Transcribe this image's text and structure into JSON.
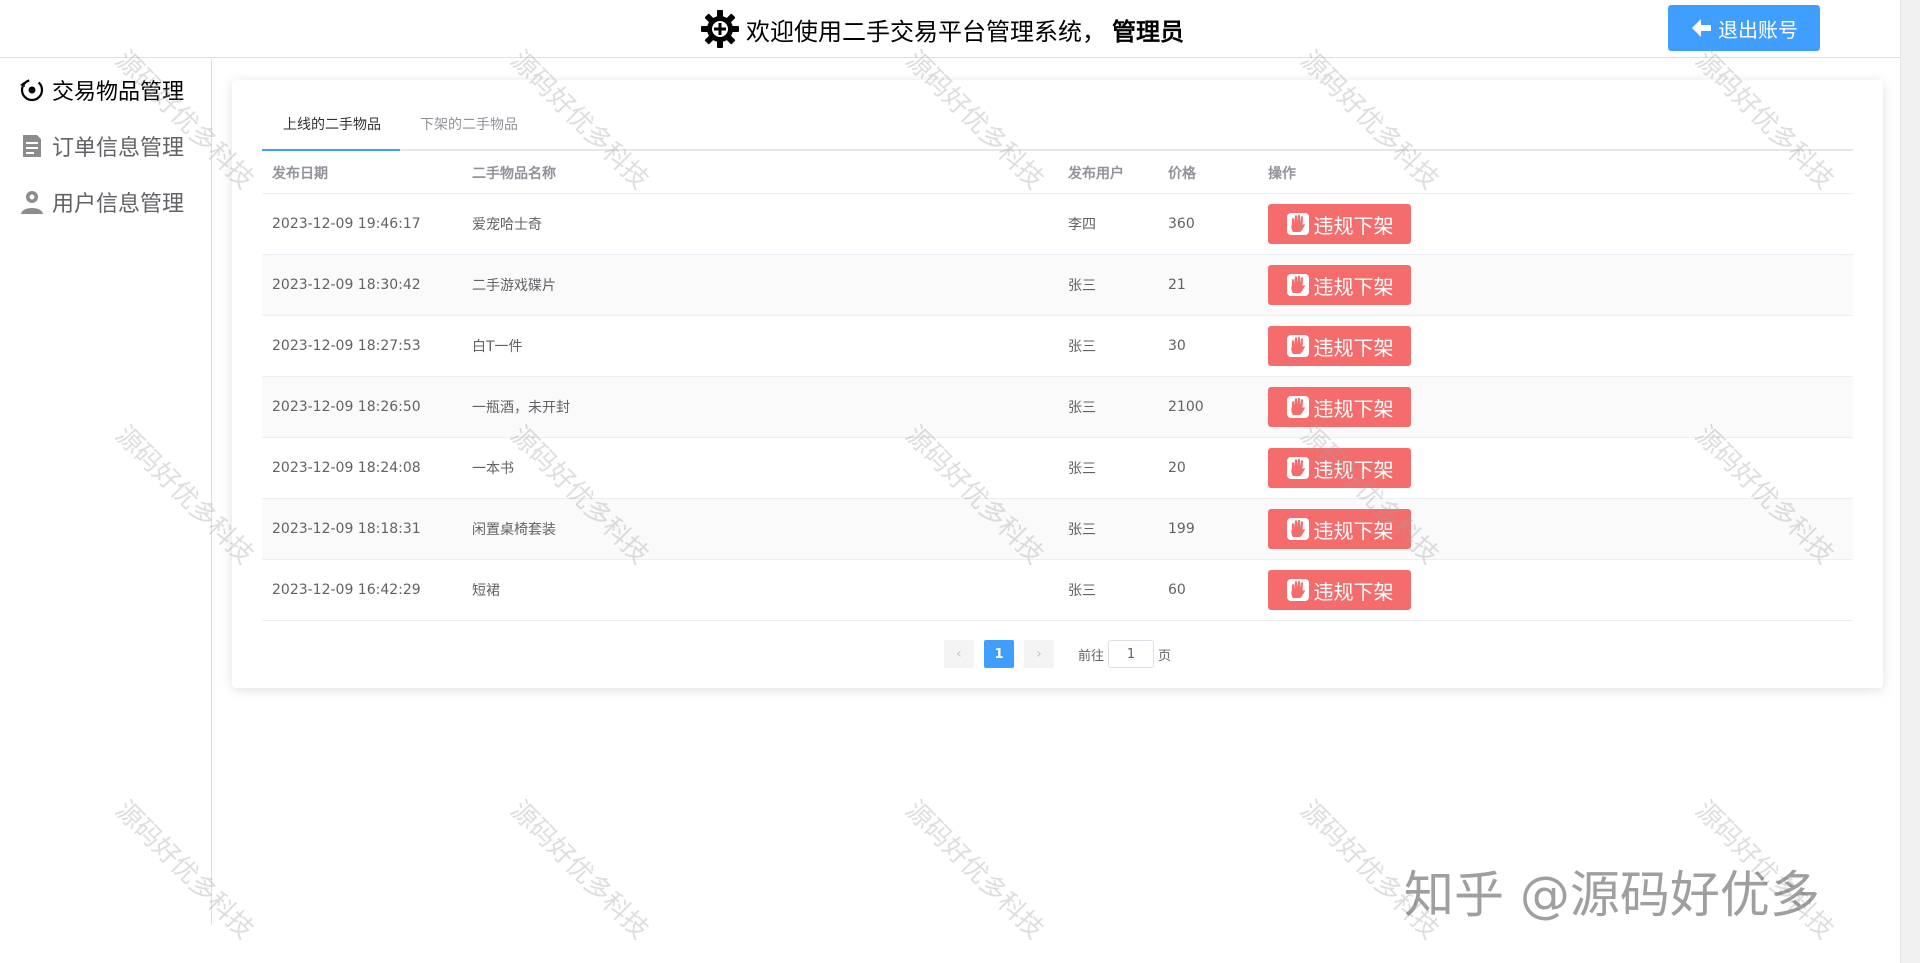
{
  "header": {
    "title_prefix": "欢迎使用二手交易平台管理系统，",
    "title_user": "管理员",
    "logout_label": "退出账号",
    "accent_color": "#409eff"
  },
  "sidebar": {
    "items": [
      {
        "label": "交易物品管理",
        "icon": "item-swap-icon",
        "active": true
      },
      {
        "label": "订单信息管理",
        "icon": "document-icon",
        "active": false
      },
      {
        "label": "用户信息管理",
        "icon": "user-icon",
        "active": false
      }
    ]
  },
  "tabs": [
    {
      "label": "上线的二手物品",
      "active": true
    },
    {
      "label": "下架的二手物品",
      "active": false
    }
  ],
  "table": {
    "columns": [
      "发布日期",
      "二手物品名称",
      "发布用户",
      "价格",
      "操作"
    ],
    "action_label": "违规下架",
    "action_color": "#f56c6c",
    "rows": [
      {
        "date": "2023-12-09 19:46:17",
        "name": "爱宠哈士奇",
        "user": "李四",
        "price": "360"
      },
      {
        "date": "2023-12-09 18:30:42",
        "name": "二手游戏碟片",
        "user": "张三",
        "price": "21"
      },
      {
        "date": "2023-12-09 18:27:53",
        "name": "白T一件",
        "user": "张三",
        "price": "30"
      },
      {
        "date": "2023-12-09 18:26:50",
        "name": "一瓶酒，未开封",
        "user": "张三",
        "price": "2100"
      },
      {
        "date": "2023-12-09 18:24:08",
        "name": "一本书",
        "user": "张三",
        "price": "20"
      },
      {
        "date": "2023-12-09 18:18:31",
        "name": "闲置桌椅套装",
        "user": "张三",
        "price": "199"
      },
      {
        "date": "2023-12-09 16:42:29",
        "name": "短裙",
        "user": "张三",
        "price": "60"
      }
    ]
  },
  "pagination": {
    "prev_icon": "chevron-left-icon",
    "next_icon": "chevron-right-icon",
    "current_page": "1",
    "goto_label": "前往",
    "goto_value": "1",
    "page_suffix": "页"
  },
  "watermark": {
    "text": "源码好优多科技",
    "brand": "知乎 @源码好优多"
  }
}
